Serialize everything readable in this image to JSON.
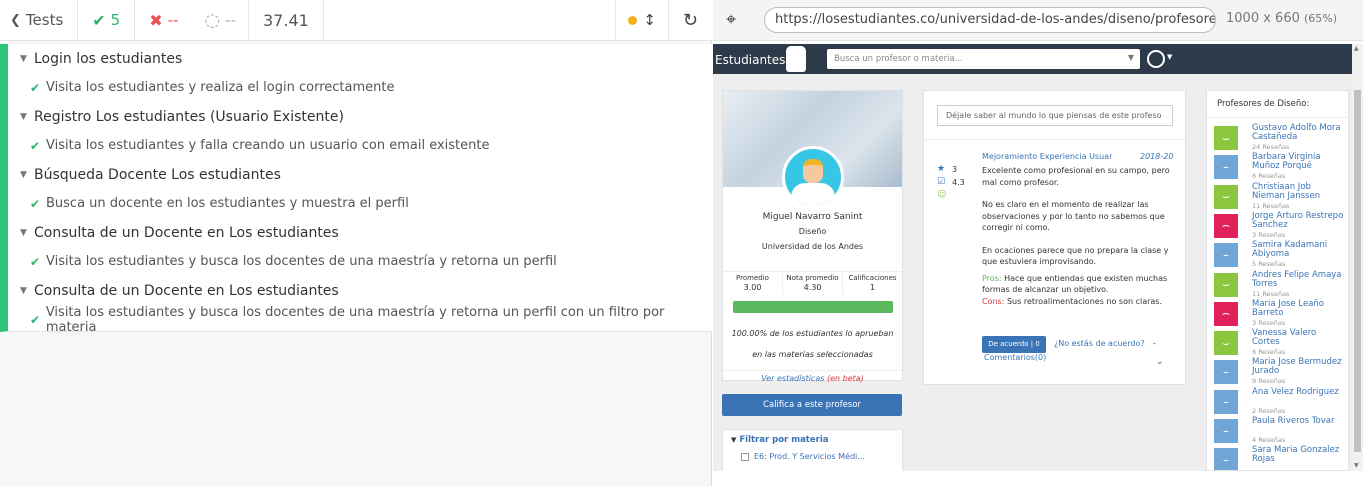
{
  "toolbar": {
    "tests_label": "Tests",
    "passed": "5",
    "failed": "--",
    "pending": "--",
    "duration": "37.41"
  },
  "suites": [
    {
      "title": "Login los estudiantes",
      "test": "Visita los estudiantes y realiza el login correctamente"
    },
    {
      "title": "Registro Los estudiantes (Usuario Existente)",
      "test": "Visita los estudiantes y falla creando un usuario con email existente"
    },
    {
      "title": "Búsqueda Docente Los estudiantes",
      "test": "Busca un docente en los estudiantes y muestra el perfil"
    },
    {
      "title": "Consulta de un Docente en Los estudiantes",
      "test": "Visita los estudiantes y busca los docentes de una maestría y retorna un perfil"
    },
    {
      "title": "Consulta de un Docente en Los estudiantes",
      "test": "Visita los estudiantes y busca los docentes de una maestría y retorna un perfil con un filtro por materia"
    }
  ],
  "browser": {
    "url": "https://losestudiantes.co/universidad-de-los-andes/diseno/profesores/m",
    "size": "1000 x 660",
    "zoom": "(65%)"
  },
  "site": {
    "brand": "Estudiantes",
    "search_placeholder": "Busca un profesor o materia..."
  },
  "profile": {
    "name": "Miguel Navarro Sanint",
    "dept": "Diseño",
    "univ": "Universidad de los Andes",
    "stats": [
      {
        "label": "Promedio",
        "value": "3.00"
      },
      {
        "label": "Nota promedio",
        "value": "4.30"
      },
      {
        "label": "Calificaciones",
        "value": "1"
      }
    ],
    "pass_pct": "100.00% de los estudiantes lo aprueban",
    "pass_sub": "en las materias seleccionadas",
    "stats_link": "Ver estadísticas",
    "beta": "(en beta)"
  },
  "rate_button": "Califica a este profesor",
  "filter": {
    "title": "Filtrar por materia",
    "item": "E6: Prod. Y Servicios Médi..."
  },
  "review": {
    "input_placeholder": "Déjale saber al mundo lo que piensas de este profeso",
    "course": "Mejoramiento Experiencia Usuar",
    "period": "2018-20",
    "score1": "3",
    "score2": "4.3",
    "p1": "Excelente como profesional en su campo, pero mal como profesor.",
    "p2": "No es claro en el momento de realizar las observaciones y por lo tanto no sabemos que corregir ni como.",
    "p3": "En ocaciones parece que no prepara la clase y que estuviera improvisando.",
    "pros_label": "Pros:",
    "pros": "Hace que entiendas que existen muchas formas de alcanzar un objetivo.",
    "cons_label": "Cons:",
    "cons": "Sus retroalimentaciones no son claras.",
    "agree": "De acuerdo | 0",
    "disagree": "¿No estás de acuerdo?",
    "dash": "-",
    "comments": "Comentarios(0)"
  },
  "side_title": "Profesores de Diseño:",
  "professors": [
    {
      "name": "Gustavo Adolfo Mora Castañeda",
      "reviews": "24 Reseñas",
      "mood": "happy",
      "color": "#8cc63f"
    },
    {
      "name": "Barbara Virginia Muñoz Porqué",
      "reviews": "6 Reseñas",
      "mood": "neutral",
      "color": "#6fa6d6"
    },
    {
      "name": "Christiaan Job Nieman Janssen",
      "reviews": "11 Reseñas",
      "mood": "happy",
      "color": "#8cc63f"
    },
    {
      "name": "Jorge Arturo Restrepo Sanchez",
      "reviews": "3 Reseñas",
      "mood": "sad",
      "color": "#e2215b"
    },
    {
      "name": "Samira Kadamani Abiyoma",
      "reviews": "5 Reseñas",
      "mood": "neutral",
      "color": "#6fa6d6"
    },
    {
      "name": "Andres Felipe Amaya Torres",
      "reviews": "11 Reseñas",
      "mood": "happy",
      "color": "#8cc63f"
    },
    {
      "name": "Maria Jose Leaño Barreto",
      "reviews": "3 Reseñas",
      "mood": "sad",
      "color": "#e2215b"
    },
    {
      "name": "Vanessa Valero Cortes",
      "reviews": "6 Reseñas",
      "mood": "happy",
      "color": "#8cc63f"
    },
    {
      "name": "Maria Jose Bermudez Jurado",
      "reviews": "9 Reseñas",
      "mood": "neutral",
      "color": "#6fa6d6"
    },
    {
      "name": "Ana Velez Rodriguez",
      "reviews": "2 Reseñas",
      "mood": "neutral",
      "color": "#6fa6d6"
    },
    {
      "name": "Paula Riveros Tovar",
      "reviews": "4 Reseñas",
      "mood": "neutral",
      "color": "#6fa6d6"
    },
    {
      "name": "Sara Maria Gonzalez Rojas",
      "reviews": "",
      "mood": "neutral",
      "color": "#6fa6d6"
    }
  ]
}
